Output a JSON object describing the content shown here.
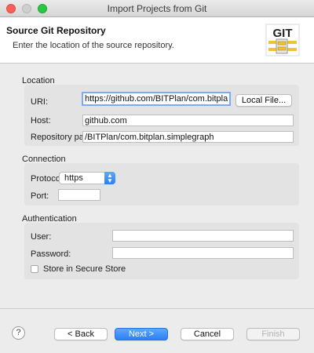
{
  "window": {
    "title": "Import Projects from Git"
  },
  "banner": {
    "title": "Source Git Repository",
    "message": "Enter the location of the source repository.",
    "logo_text": "GIT"
  },
  "location": {
    "section_label": "Location",
    "uri_label": "URI:",
    "uri_value": "https://github.com/BITPlan/com.bitplan.",
    "local_file_button": "Local File...",
    "host_label": "Host:",
    "host_value": "github.com",
    "repo_path_label": "Repository path:",
    "repo_path_value": "/BITPlan/com.bitplan.simplegraph"
  },
  "connection": {
    "section_label": "Connection",
    "protocol_label": "Protocol:",
    "protocol_value": "https",
    "port_label": "Port:",
    "port_value": ""
  },
  "authentication": {
    "section_label": "Authentication",
    "user_label": "User:",
    "user_value": "",
    "password_label": "Password:",
    "password_value": "",
    "store_label": "Store in Secure Store",
    "store_checked": false
  },
  "footer": {
    "help": "?",
    "back": "< Back",
    "next": "Next >",
    "cancel": "Cancel",
    "finish": "Finish"
  },
  "colors": {
    "primary_button": "#2c7ef5",
    "focus_ring": "#7baaf0",
    "close_light": "#fc5f57",
    "zoom_light": "#28c940"
  },
  "icons": [
    "close-light-icon",
    "minimize-light-icon",
    "zoom-light-icon",
    "git-logo-icon",
    "chevron-updown-icon",
    "help-icon"
  ]
}
